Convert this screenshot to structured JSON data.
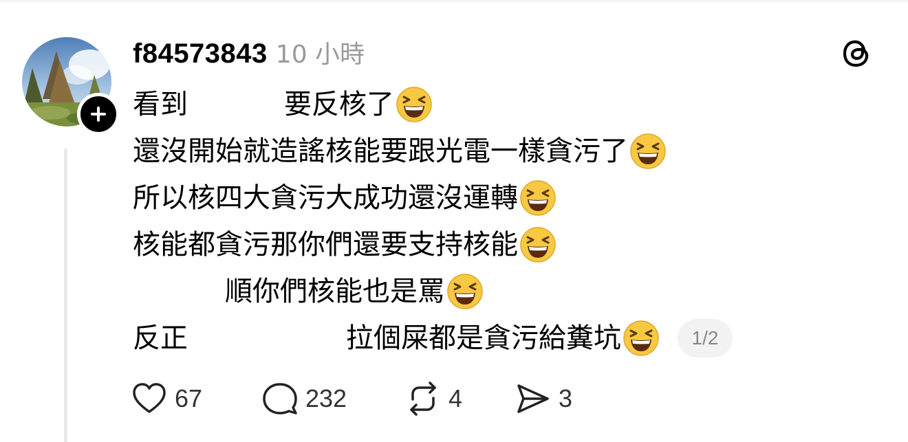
{
  "post": {
    "username": "f84573843",
    "timestamp": "10 小時",
    "lines": [
      {
        "parts": [
          "看到",
          "要反核了"
        ]
      },
      {
        "parts": [
          "還沒開始就造謠核能要跟光電一樣貪污了"
        ]
      },
      {
        "parts": [
          "所以核四大貪污大成功還沒運轉"
        ]
      },
      {
        "parts": [
          "核能都貪污那你們還要支持核能"
        ]
      },
      {
        "parts": [
          "順你們核能也是罵"
        ]
      },
      {
        "parts": [
          "反正",
          "拉個屎都是貪污給糞坑"
        ]
      }
    ],
    "page_indicator": "1/2",
    "emoji": "grinning-squinting-face",
    "actions": {
      "likes": "67",
      "replies": "232",
      "reposts": "4",
      "shares": "3"
    },
    "icons": {
      "like": "heart-icon",
      "reply": "speech-bubble-icon",
      "repost": "repost-icon",
      "share": "send-icon",
      "app": "threads-logo-icon",
      "follow": "plus-icon"
    }
  }
}
